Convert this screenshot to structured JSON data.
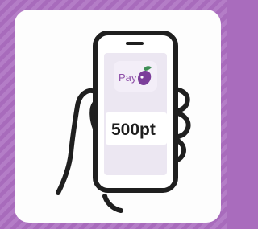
{
  "app": {
    "logo_text": "Pay",
    "logo_icon": "eggplant-icon",
    "points_text": "500pt"
  },
  "colors": {
    "frame_purple": "#a86bbc",
    "frame_stripe": "#b47dc7",
    "card_white": "#fdfdfd",
    "screen_tint": "#ece7f2",
    "logo_bg": "#f3eef8",
    "eggplant_purple": "#7b3e9a",
    "outline": "#1f1f1f"
  }
}
